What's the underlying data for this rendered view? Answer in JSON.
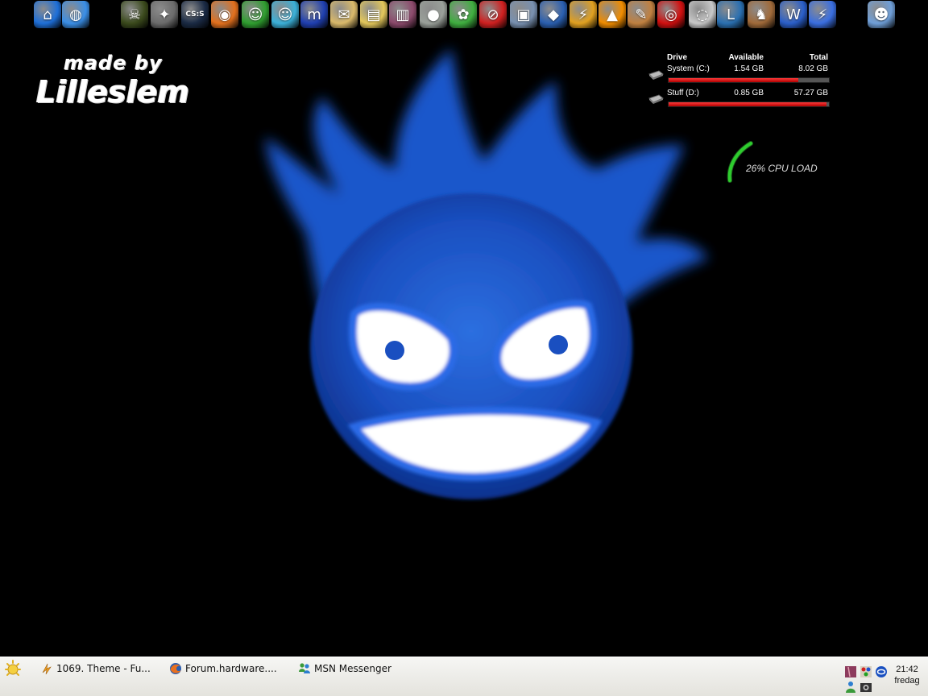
{
  "dock": {
    "items": [
      {
        "name": "home-icon",
        "glyph": "⌂",
        "color": "#1e6fd8"
      },
      {
        "name": "internet-globe-icon",
        "glyph": "◍",
        "color": "#3a8ee6"
      },
      {
        "name": "game-monster-icon",
        "glyph": "☠",
        "color": "#3b4a1c"
      },
      {
        "name": "counter-strike-icon",
        "glyph": "✦",
        "color": "#6b6b6b"
      },
      {
        "name": "css-game-icon",
        "glyph": "CS:S",
        "color": "#1a2a44"
      },
      {
        "name": "firefox-icon",
        "glyph": "◉",
        "color": "#e2701d"
      },
      {
        "name": "msn-buddies-icon",
        "glyph": "☺",
        "color": "#2f9e2f"
      },
      {
        "name": "msn-buddies-2-icon",
        "glyph": "☺",
        "color": "#3bb0d8"
      },
      {
        "name": "mirc-icon",
        "glyph": "m",
        "color": "#1f3fb0"
      },
      {
        "name": "envelope-icon",
        "glyph": "✉",
        "color": "#d9b96a"
      },
      {
        "name": "folder-icon",
        "glyph": "▤",
        "color": "#e3c75b"
      },
      {
        "name": "wallpaper-icon",
        "glyph": "▥",
        "color": "#8c4a6c"
      },
      {
        "name": "circle-app-icon",
        "glyph": "●",
        "color": "#9aa09a"
      },
      {
        "name": "yoshi-icon",
        "glyph": "✿",
        "color": "#3fae3f"
      },
      {
        "name": "no-sign-icon",
        "glyph": "⊘",
        "color": "#d02020"
      },
      {
        "name": "monitor-icon",
        "glyph": "▣",
        "color": "#7890b0"
      },
      {
        "name": "paint-bucket-icon",
        "glyph": "◆",
        "color": "#2a5fb0"
      },
      {
        "name": "winamp-icon",
        "glyph": "⚡",
        "color": "#e0a020"
      },
      {
        "name": "vlc-icon",
        "glyph": "▲",
        "color": "#f08c00"
      },
      {
        "name": "palette-icon",
        "glyph": "✎",
        "color": "#c08040"
      },
      {
        "name": "target-icon",
        "glyph": "◎",
        "color": "#d01010"
      },
      {
        "name": "cd-icon",
        "glyph": "◌",
        "color": "#c8c8c8"
      },
      {
        "name": "l-app-icon",
        "glyph": "L",
        "color": "#2a6fb0"
      },
      {
        "name": "squirrel-icon",
        "glyph": "♞",
        "color": "#a06a3a"
      },
      {
        "name": "word-icon",
        "glyph": "W",
        "color": "#2a5ec8"
      },
      {
        "name": "lightning-icon",
        "glyph": "⚡",
        "color": "#3a6ee0"
      },
      {
        "name": "user-icon",
        "glyph": "☻",
        "color": "#6f9fd8"
      }
    ]
  },
  "madeby": {
    "line1": "made by",
    "line2": "Lilleslem"
  },
  "drives": {
    "headers": {
      "drive": "Drive",
      "available": "Available",
      "total": "Total"
    },
    "rows": [
      {
        "name": "System (C:)",
        "available": "1.54 GB",
        "total": "8.02 GB",
        "used_fraction": 0.81
      },
      {
        "name": "Stuff (D:)",
        "available": "0.85 GB",
        "total": "57.27 GB",
        "used_fraction": 0.985
      }
    ],
    "bar_color": "#e01010"
  },
  "cpu": {
    "label": "26% CPU LOAD",
    "value": 0.26,
    "color": "#2ecc2e"
  },
  "taskbar": {
    "tasks": [
      {
        "label": "1069. Theme - Fu...",
        "icon": "winamp-icon"
      },
      {
        "label": "Forum.hardware....",
        "icon": "firefox-icon"
      },
      {
        "label": "MSN Messenger",
        "icon": "msn-icon"
      }
    ],
    "clock": {
      "time": "21:42",
      "day": "fredag"
    }
  },
  "colors": {
    "desktop": "#000000",
    "mascot_blue": "#1550c8",
    "mascot_light": "#4a8cf0"
  }
}
